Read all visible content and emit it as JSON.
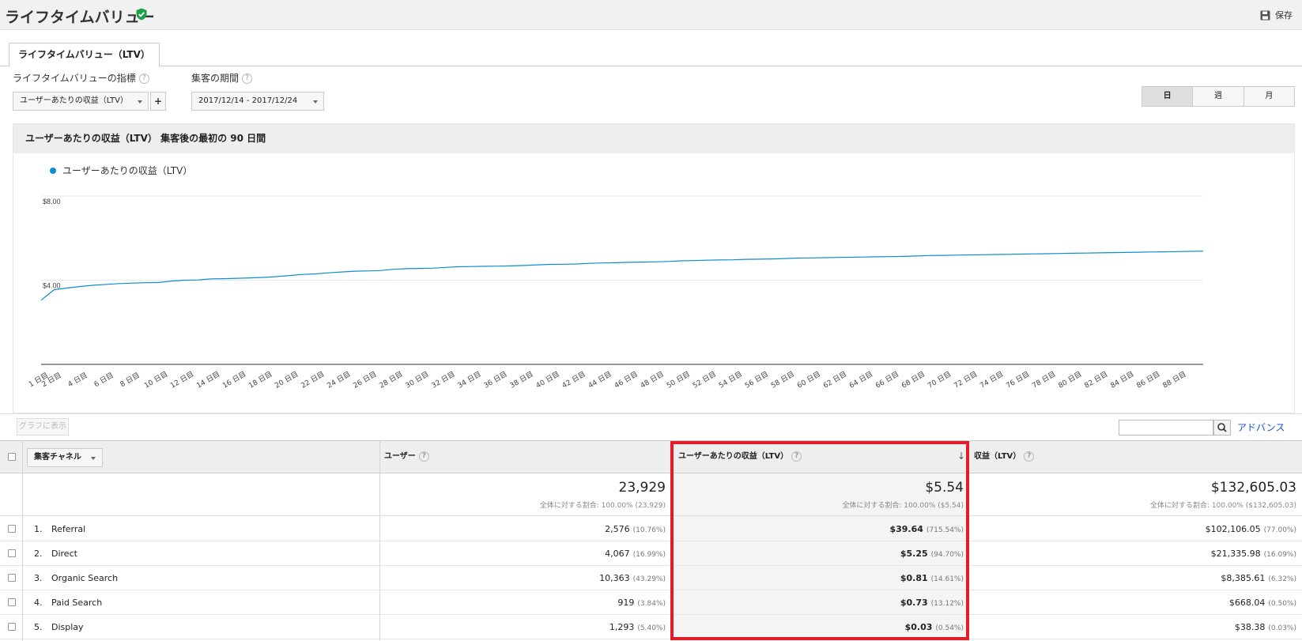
{
  "header": {
    "title": "ライフタイムバリュー",
    "save_label": "保存"
  },
  "tabs": [
    {
      "label": "ライフタイムバリュー（LTV）",
      "active": true
    }
  ],
  "controls": {
    "metric_label": "ライフタイムバリューの指標",
    "metric_value": "ユーザーあたりの収益（LTV）",
    "add_label": "+",
    "period_label": "集客の期間",
    "period_value": "2017/12/14 - 2017/12/24",
    "help": "?",
    "granularity": [
      "日",
      "週",
      "月"
    ],
    "granularity_selected": "日"
  },
  "chart": {
    "heading": "ユーザーあたりの収益（LTV） 集客後の最初の 90 日間",
    "legend": "ユーザーあたりの収益（LTV）",
    "color": "#0a8fd0"
  },
  "chart_data": {
    "type": "line",
    "x_tick_labels": [
      "1 日目",
      "2 日目",
      "4 日目",
      "6 日目",
      "8 日目",
      "10 日目",
      "12 日目",
      "14 日目",
      "16 日目",
      "18 日目",
      "20 日目",
      "22 日目",
      "24 日目",
      "26 日目",
      "28 日目",
      "30 日目",
      "32 日目",
      "34 日目",
      "36 日目",
      "38 日目",
      "40 日目",
      "42 日目",
      "44 日目",
      "46 日目",
      "48 日目",
      "50 日目",
      "52 日目",
      "54 日目",
      "56 日目",
      "58 日目",
      "60 日目",
      "62 日目",
      "64 日目",
      "66 日目",
      "68 日目",
      "70 日目",
      "72 日目",
      "74 日目",
      "76 日目",
      "78 日目",
      "80 日目",
      "82 日目",
      "84 日目",
      "86 日目",
      "88 日目"
    ],
    "y_ticks": [
      "$4.00",
      "$8.00"
    ],
    "ylim": [
      0,
      8
    ],
    "series": [
      {
        "name": "ユーザーあたりの収益（LTV）",
        "x": [
          1,
          2,
          3,
          4,
          5,
          6,
          7,
          8,
          9,
          10,
          11,
          12,
          13,
          14,
          15,
          16,
          17,
          18,
          19,
          20,
          21,
          22,
          23,
          24,
          25,
          26,
          27,
          28,
          29,
          30,
          31,
          32,
          33,
          34,
          35,
          36,
          37,
          38,
          39,
          40,
          41,
          42,
          43,
          44,
          45,
          46,
          47,
          48,
          49,
          50,
          51,
          52,
          53,
          54,
          55,
          56,
          57,
          58,
          59,
          60,
          61,
          62,
          63,
          64,
          65,
          66,
          67,
          68,
          69,
          70,
          71,
          72,
          73,
          74,
          75,
          76,
          77,
          78,
          79,
          80,
          81,
          82,
          83,
          84,
          85,
          86,
          87,
          88,
          89,
          90
        ],
        "values": [
          3.05,
          3.55,
          3.63,
          3.7,
          3.76,
          3.8,
          3.84,
          3.86,
          3.88,
          3.89,
          3.96,
          4.0,
          4.01,
          4.06,
          4.07,
          4.09,
          4.11,
          4.13,
          4.17,
          4.22,
          4.27,
          4.3,
          4.35,
          4.39,
          4.43,
          4.44,
          4.46,
          4.52,
          4.55,
          4.56,
          4.57,
          4.61,
          4.64,
          4.65,
          4.66,
          4.67,
          4.68,
          4.7,
          4.73,
          4.75,
          4.76,
          4.77,
          4.8,
          4.82,
          4.83,
          4.85,
          4.86,
          4.87,
          4.89,
          4.92,
          4.93,
          4.95,
          4.96,
          4.97,
          4.99,
          5.0,
          5.01,
          5.03,
          5.05,
          5.06,
          5.07,
          5.08,
          5.09,
          5.1,
          5.11,
          5.12,
          5.13,
          5.15,
          5.17,
          5.18,
          5.19,
          5.2,
          5.21,
          5.22,
          5.23,
          5.24,
          5.25,
          5.26,
          5.27,
          5.28,
          5.29,
          5.3,
          5.31,
          5.32,
          5.33,
          5.34,
          5.35,
          5.36,
          5.37,
          5.38
        ]
      }
    ],
    "grid": true
  },
  "toolbar": {
    "graph_button": "グラフに表示",
    "advanced_link": "アドバンス",
    "search_value": ""
  },
  "table": {
    "headers": {
      "dimension": "集客チャネル",
      "users": "ユーザー",
      "ltv": "ユーザーあたりの収益（LTV）",
      "revenue": "収益（LTV）"
    },
    "totals": {
      "users": "23,929",
      "users_sub": "全体に対する割合: 100.00% (23,929)",
      "ltv": "$5.54",
      "ltv_sub": "全体に対する割合: 100.00% ($5.54)",
      "revenue": "$132,605.03",
      "revenue_sub": "全体に対する割合: 100.00% ($132,605.03)"
    },
    "rows": [
      {
        "num": "1.",
        "name": "Referral",
        "users": "2,576",
        "users_pct": "(10.76%)",
        "ltv": "$39.64",
        "ltv_pct": "(715.54%)",
        "revenue": "$102,106.05",
        "revenue_pct": "(77.00%)"
      },
      {
        "num": "2.",
        "name": "Direct",
        "users": "4,067",
        "users_pct": "(16.99%)",
        "ltv": "$5.25",
        "ltv_pct": "(94.70%)",
        "revenue": "$21,335.98",
        "revenue_pct": "(16.09%)"
      },
      {
        "num": "3.",
        "name": "Organic Search",
        "users": "10,363",
        "users_pct": "(43.29%)",
        "ltv": "$0.81",
        "ltv_pct": "(14.61%)",
        "revenue": "$8,385.61",
        "revenue_pct": "(6.32%)"
      },
      {
        "num": "4.",
        "name": "Paid Search",
        "users": "919",
        "users_pct": "(3.84%)",
        "ltv": "$0.73",
        "ltv_pct": "(13.12%)",
        "revenue": "$668.04",
        "revenue_pct": "(0.50%)"
      },
      {
        "num": "5.",
        "name": "Display",
        "users": "1,293",
        "users_pct": "(5.40%)",
        "ltv": "$0.03",
        "ltv_pct": "(0.54%)",
        "revenue": "$38.38",
        "revenue_pct": "(0.03%)"
      }
    ]
  },
  "highlight_color": "#e41c27"
}
